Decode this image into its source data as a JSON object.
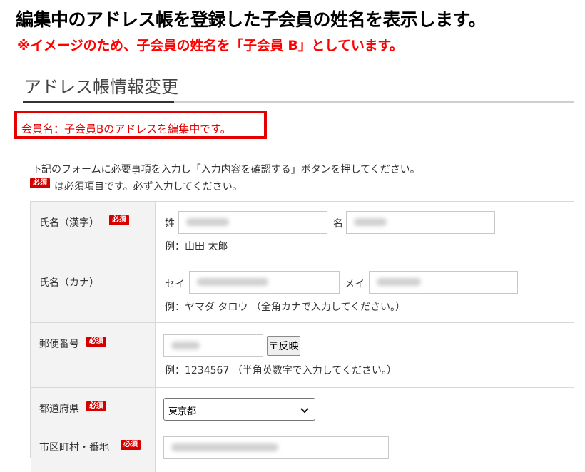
{
  "heading": {
    "line1": "編集中のアドレス帳を登録した子会員の姓名を表示します。",
    "line2": "※イメージのため、子会員の姓名を「子会員 B」としています。"
  },
  "section_title": "アドレス帳情報変更",
  "member_note": "会員名：子会員Bのアドレスを編集中です。",
  "instructions": {
    "line1": "下記のフォームに必要事項を入力し「入力内容を確認する」ボタンを押してください。",
    "line2": "は必須項目です。必ず入力してください。"
  },
  "required_badge": "必須",
  "form": {
    "name_kanji": {
      "label": "氏名（漢字）",
      "required": true,
      "sei_label": "姓",
      "mei_label": "名",
      "example": "例：山田 太郎"
    },
    "name_kana": {
      "label": "氏名（カナ）",
      "required": false,
      "sei_label": "セイ",
      "mei_label": "メイ",
      "example": "例：ヤマダ タロウ （全角カナで入力してください。）"
    },
    "zip": {
      "label": "郵便番号",
      "required": true,
      "button_label": "〒反映",
      "example": "例：1234567 （半角英数字で入力してください。）"
    },
    "prefecture": {
      "label": "都道府県",
      "required": true,
      "selected": "東京都"
    },
    "city": {
      "label": "市区町村・番地",
      "required": true
    }
  },
  "colors": {
    "accent_red": "#e60000",
    "badge_red": "#d40000",
    "header_bg": "#f3f3f3"
  }
}
